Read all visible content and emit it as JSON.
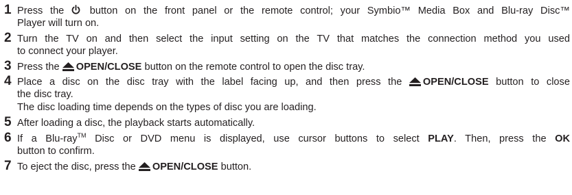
{
  "steps": [
    {
      "number": "1",
      "line1_before": "Press the",
      "power_icon": "power-icon",
      "line1_after": "button on the front panel or the remote control; your Symbio™ Media Box and Blu-ray Disc™",
      "line2": "Player will turn on."
    },
    {
      "number": "2",
      "line1": "Turn the TV on and then select the input setting on the TV that matches the connection method you used",
      "line2": "to connect your player."
    },
    {
      "number": "3",
      "before": "Press the",
      "eject_icon": "eject-icon",
      "button": "OPEN/CLOSE",
      "after": "button on the remote control to open the disc tray."
    },
    {
      "number": "4",
      "line1_before": "Place a disc on the disc tray with the label facing up, and then press the",
      "eject_icon": "eject-icon",
      "button": "OPEN/CLOSE",
      "line1_after": "button to close",
      "line2": "the disc tray.",
      "note": "The disc loading time depends on the types of disc you are loading."
    },
    {
      "number": "5",
      "text": "After loading a disc, the playback starts automatically."
    },
    {
      "number": "6",
      "line1_a": "If a Blu-ray",
      "tm": "TM",
      "line1_b": "Disc or DVD menu is displayed, use cursor buttons to select",
      "play": "PLAY",
      "line1_c": ". Then, press the",
      "ok": "OK",
      "line2": "button to confirm."
    },
    {
      "number": "7",
      "before": "To eject the disc, press the",
      "eject_icon": "eject-icon",
      "button": "OPEN/CLOSE",
      "after": "button."
    }
  ]
}
